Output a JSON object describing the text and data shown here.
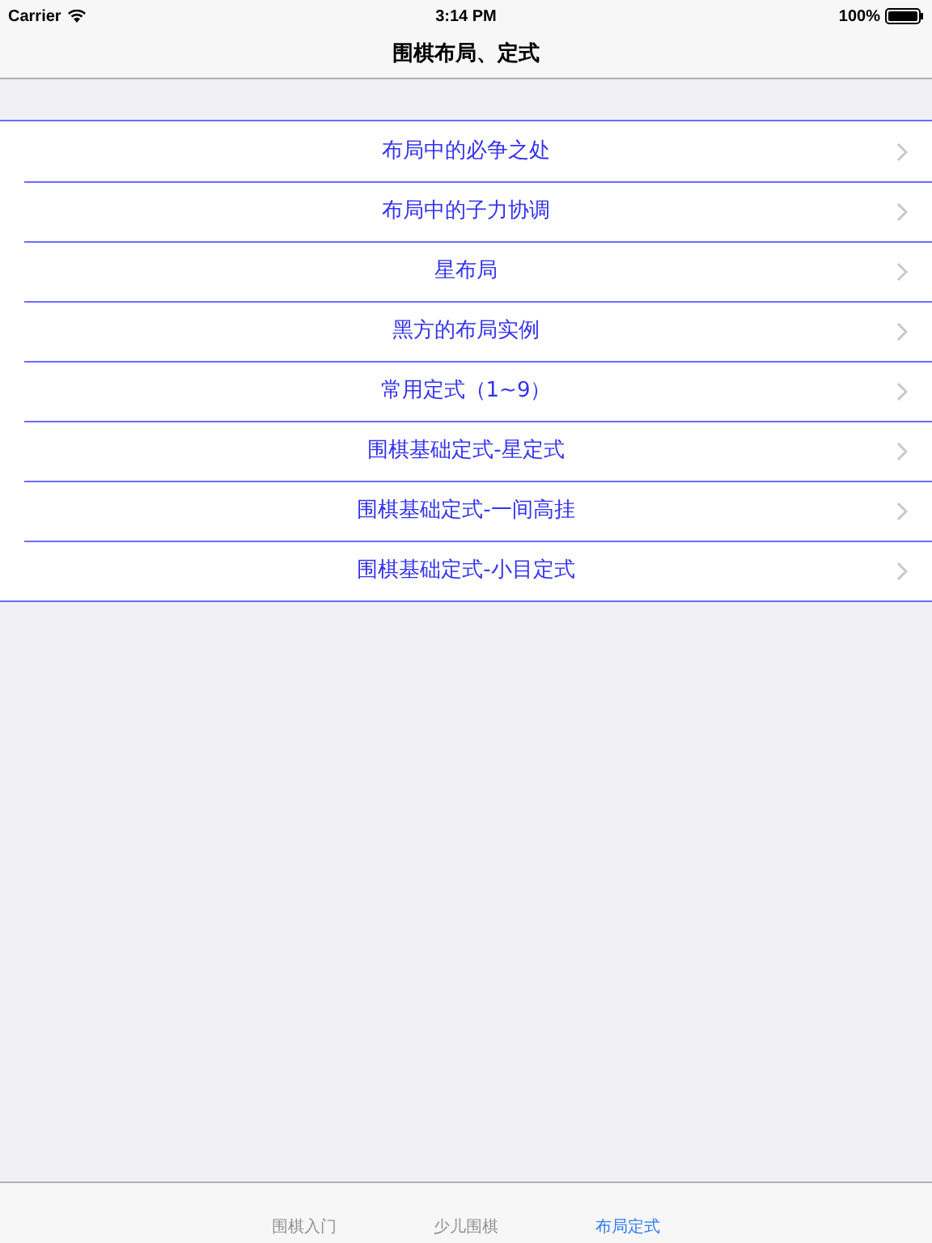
{
  "status_bar": {
    "carrier": "Carrier",
    "time": "3:14 PM",
    "battery": "100%"
  },
  "nav_bar": {
    "title": "围棋布局、定式"
  },
  "list": [
    {
      "label": "布局中的必争之处"
    },
    {
      "label": "布局中的子力协调"
    },
    {
      "label": "星布局"
    },
    {
      "label": "黑方的布局实例"
    },
    {
      "label": "常用定式（1~9）"
    },
    {
      "label": "围棋基础定式-星定式"
    },
    {
      "label": "围棋基础定式-一间高挂"
    },
    {
      "label": "围棋基础定式-小目定式"
    }
  ],
  "tab_bar": [
    {
      "label": "围棋入门",
      "selected": false
    },
    {
      "label": "少儿围棋",
      "selected": false
    },
    {
      "label": "布局定式",
      "selected": true
    }
  ]
}
